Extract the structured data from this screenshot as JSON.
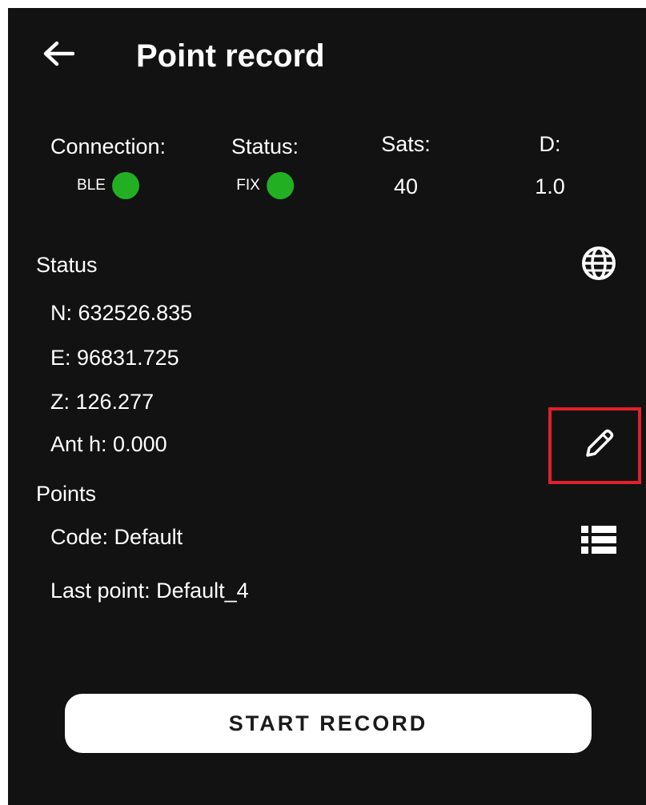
{
  "app_bar": {
    "back_icon": "arrow-left-icon",
    "title": "Point record"
  },
  "stats": {
    "connection": {
      "label": "Connection:",
      "value": "BLE",
      "indicator_color": "#22b022"
    },
    "status": {
      "label": "Status:",
      "value": "FIX",
      "indicator_color": "#22b022"
    },
    "sats": {
      "label": "Sats:",
      "value": "40"
    },
    "d": {
      "label": "D:",
      "value": "1.0"
    }
  },
  "status_section": {
    "title": "Status",
    "icon": "globe-icon",
    "n": "N: 632526.835",
    "e": "E: 96831.725",
    "z": "Z: 126.277",
    "ant_h": "Ant h: 0.000",
    "edit_icon": "pencil-icon",
    "highlight_color": "#e0202a"
  },
  "points_section": {
    "title": "Points",
    "code": "Code: Default",
    "list_icon": "list-icon",
    "last_point": "Last point: Default_4"
  },
  "actions": {
    "start_record": "START RECORD"
  },
  "colors": {
    "background": "#121212",
    "text": "#ffffff",
    "button_bg": "#ffffff",
    "button_text": "#1a1a1a"
  }
}
